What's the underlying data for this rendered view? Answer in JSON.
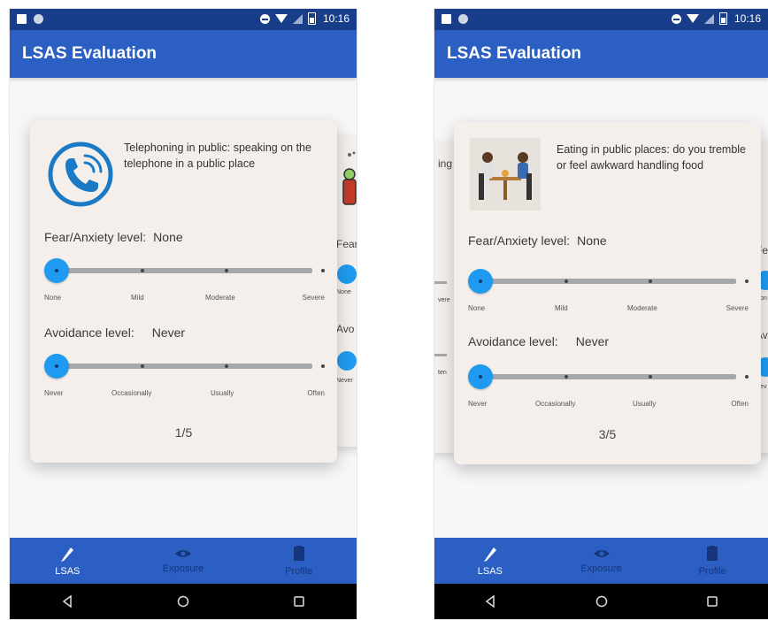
{
  "screens": [
    {
      "status": {
        "time": "10:16"
      },
      "app_title": "LSAS Evaluation",
      "card": {
        "question": "Telephoning in public: speaking on the telephone in a public place",
        "fear_label": "Fear/Anxiety level:",
        "fear_value": "None",
        "fear_scale": [
          "None",
          "Mild",
          "Moderate",
          "Severe"
        ],
        "fear_level": 0,
        "avoid_label": "Avoidance level:",
        "avoid_value": "Never",
        "avoid_scale": [
          "Never",
          "Occasionally",
          "Usually",
          "Often"
        ],
        "avoid_level": 0,
        "page": "1/5"
      },
      "next_peek": [
        "Fear",
        "None",
        "Avo",
        "Never"
      ],
      "nav": [
        "LSAS",
        "Exposure",
        "Profile"
      ]
    },
    {
      "status": {
        "time": "10:16"
      },
      "app_title": "LSAS Evaluation",
      "card": {
        "question": "Eating in public places: do you tremble or feel awkward handling food",
        "fear_label": "Fear/Anxiety level:",
        "fear_value": "None",
        "fear_scale": [
          "None",
          "Mild",
          "Moderate",
          "Severe"
        ],
        "fear_level": 0,
        "avoid_label": "Avoidance level:",
        "avoid_value": "Never",
        "avoid_scale": [
          "Never",
          "Occasionally",
          "Usually",
          "Often"
        ],
        "avoid_level": 0,
        "page": "3/5"
      },
      "prev_peek": [
        "ing",
        "vere",
        "ten"
      ],
      "next_peek": [
        "Fe",
        "Non",
        "Av",
        "Nev"
      ],
      "nav": [
        "LSAS",
        "Exposure",
        "Profile"
      ]
    }
  ],
  "colors": {
    "status_bar": "#183e8a",
    "app_bar": "#2b5fc4",
    "card": "#f4efea",
    "slider_thumb": "#1e9bf0",
    "nav_active": "#ffffff",
    "nav_inactive": "#17357a"
  }
}
